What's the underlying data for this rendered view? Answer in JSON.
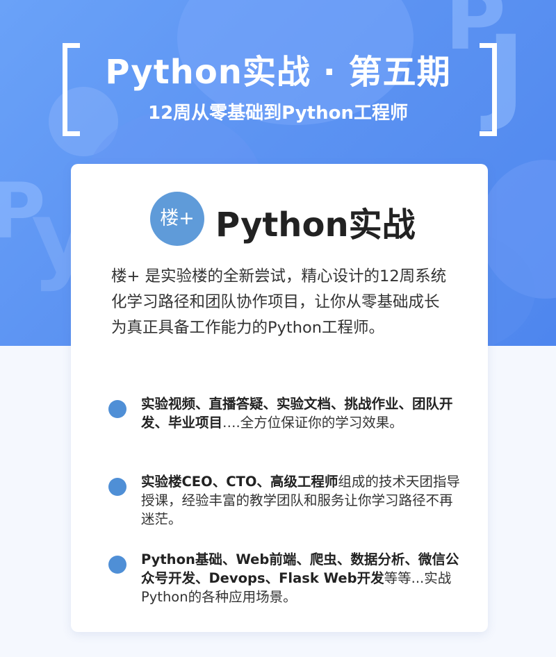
{
  "header": {
    "title": "Python实战 · 第五期",
    "subtitle": "12周从零基础到Python工程师"
  },
  "card": {
    "logo_mark": "楼+",
    "logo_text": "Python实战",
    "description": "楼+ 是实验楼的全新尝试，精心设计的12周系统化学习路径和团队协作项目，让你从零基础成长为真正具备工作能力的Python工程师。",
    "features": [
      {
        "bold": "实验视频、直播答疑、实验文档、挑战作业、团队开发、毕业项目",
        "rest": "….全方位保证你的学习效果。"
      },
      {
        "bold": "实验楼CEO、CTO、高级工程师",
        "rest": "组成的技术天团指导授课，经验丰富的教学团队和服务让你学习路径不再迷茫。"
      },
      {
        "bold": "Python基础、Web前端、爬虫、数据分析、微信公众号开发、Devops、Flask Web开发",
        "rest": "等等...实战Python的各种应用场景。"
      }
    ]
  },
  "colors": {
    "hero_blue": "#5c93f2",
    "bullet_blue": "#4f8fd6",
    "logo_blue": "#5f9bd9"
  },
  "icons": {
    "bullet": "bullet-dot-icon",
    "brand": "lou-plus-logo-icon"
  }
}
